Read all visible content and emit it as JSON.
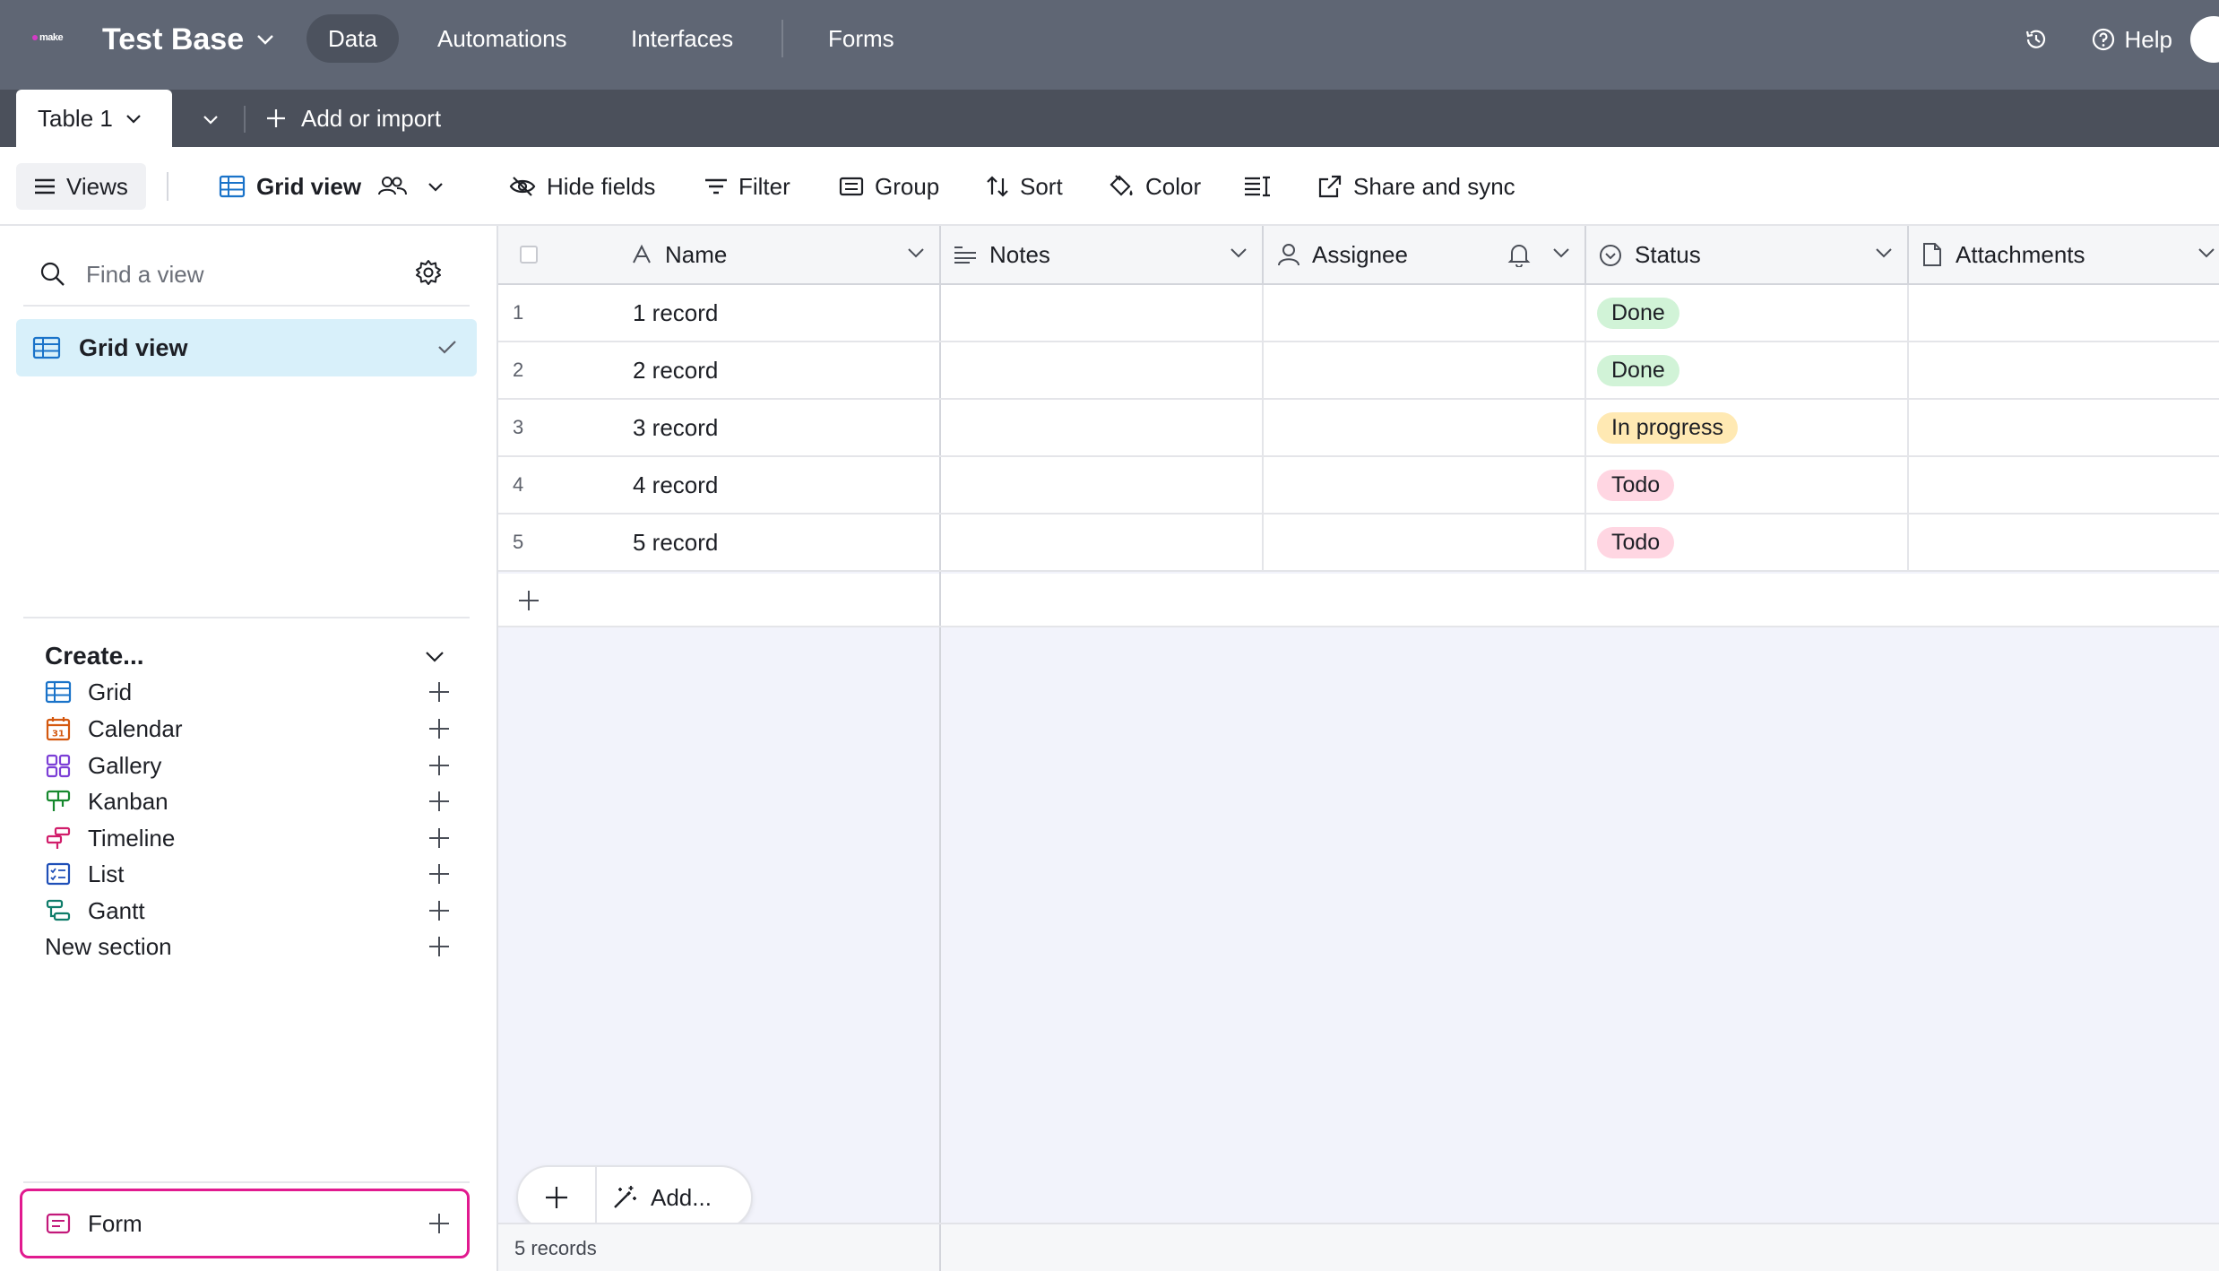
{
  "topbar": {
    "logo_text": "make",
    "base_title": "Test Base",
    "nav": [
      "Data",
      "Automations",
      "Interfaces",
      "Forms"
    ],
    "active_nav": "Data",
    "help_label": "Help"
  },
  "tabbar": {
    "table_name": "Table 1",
    "add_import_label": "Add or import"
  },
  "toolbar": {
    "views_label": "Views",
    "view_name": "Grid view",
    "hide_fields": "Hide fields",
    "filter": "Filter",
    "group": "Group",
    "sort": "Sort",
    "color": "Color",
    "share": "Share and sync"
  },
  "sidebar": {
    "find_placeholder": "Find a view",
    "active_view": "Grid view",
    "create_heading": "Create...",
    "create_items": [
      {
        "label": "Grid",
        "icon": "grid-icon",
        "color": "#1a73c9"
      },
      {
        "label": "Calendar",
        "icon": "calendar-icon",
        "color": "#d4580f"
      },
      {
        "label": "Gallery",
        "icon": "gallery-icon",
        "color": "#7c3fd6"
      },
      {
        "label": "Kanban",
        "icon": "kanban-icon",
        "color": "#16882e"
      },
      {
        "label": "Timeline",
        "icon": "timeline-icon",
        "color": "#d11e6b"
      },
      {
        "label": "List",
        "icon": "list-icon",
        "color": "#1f4fb8"
      },
      {
        "label": "Gantt",
        "icon": "gantt-icon",
        "color": "#0f7d6a"
      },
      {
        "label": "New section",
        "icon": "",
        "color": ""
      }
    ],
    "form_item": {
      "label": "Form",
      "icon": "form-icon",
      "color": "#c2187a"
    }
  },
  "grid": {
    "columns": [
      "Name",
      "Notes",
      "Assignee",
      "Status",
      "Attachments"
    ],
    "rows": [
      {
        "num": "1",
        "name": "1 record",
        "status": "Done"
      },
      {
        "num": "2",
        "name": "2 record",
        "status": "Done"
      },
      {
        "num": "3",
        "name": "3 record",
        "status": "In progress"
      },
      {
        "num": "4",
        "name": "4 record",
        "status": "Todo"
      },
      {
        "num": "5",
        "name": "5 record",
        "status": "Todo"
      }
    ],
    "status_colors": {
      "Done": "#d1f3d7",
      "In progress": "#ffe9b3",
      "Todo": "#ffd6e2"
    },
    "add_label": "Add...",
    "record_count": "5 records"
  }
}
